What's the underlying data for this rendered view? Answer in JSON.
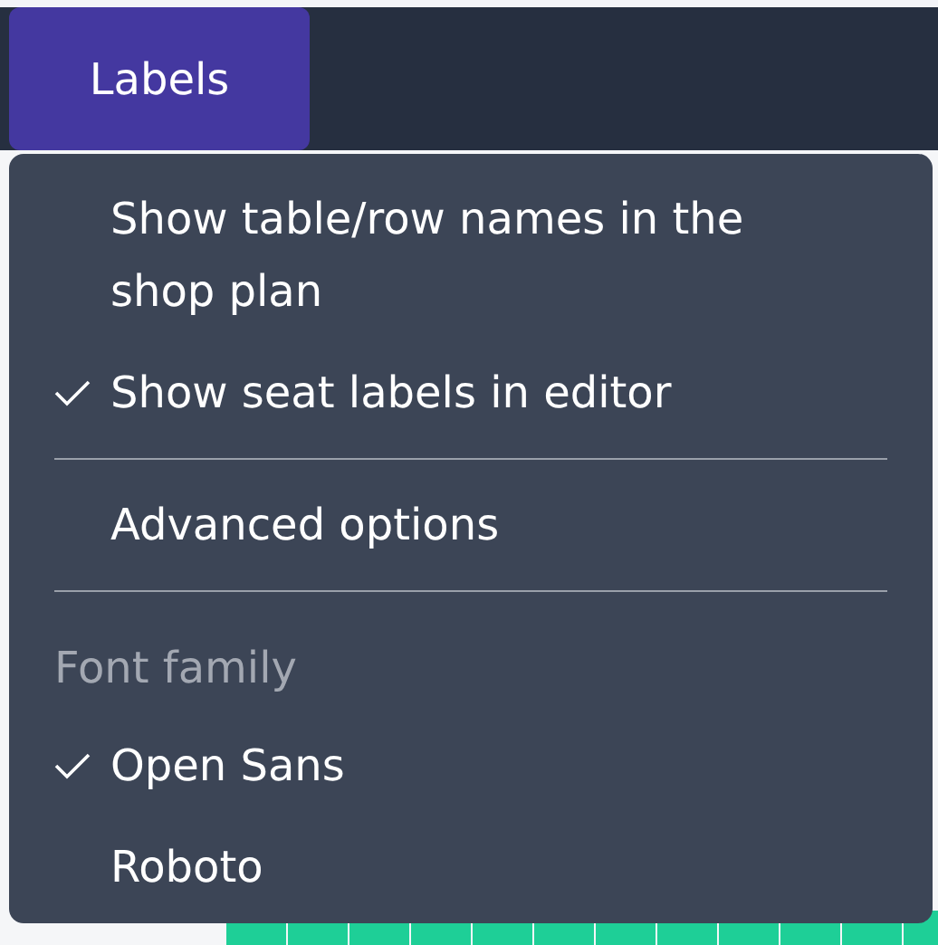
{
  "toolbar": {
    "button": {
      "label": "Labels",
      "selected": true
    }
  },
  "menu": {
    "items": [
      {
        "kind": "option",
        "label": "Show table/row names in the shop plan",
        "checked": false
      },
      {
        "kind": "option",
        "label": "Show seat labels in editor",
        "checked": true
      },
      {
        "kind": "divider"
      },
      {
        "kind": "option",
        "label": "Advanced options",
        "checked": false
      },
      {
        "kind": "divider"
      },
      {
        "kind": "header",
        "label": "Font family"
      },
      {
        "kind": "option",
        "label": "Open Sans",
        "checked": true
      },
      {
        "kind": "option",
        "label": "Roboto",
        "checked": false
      }
    ]
  }
}
